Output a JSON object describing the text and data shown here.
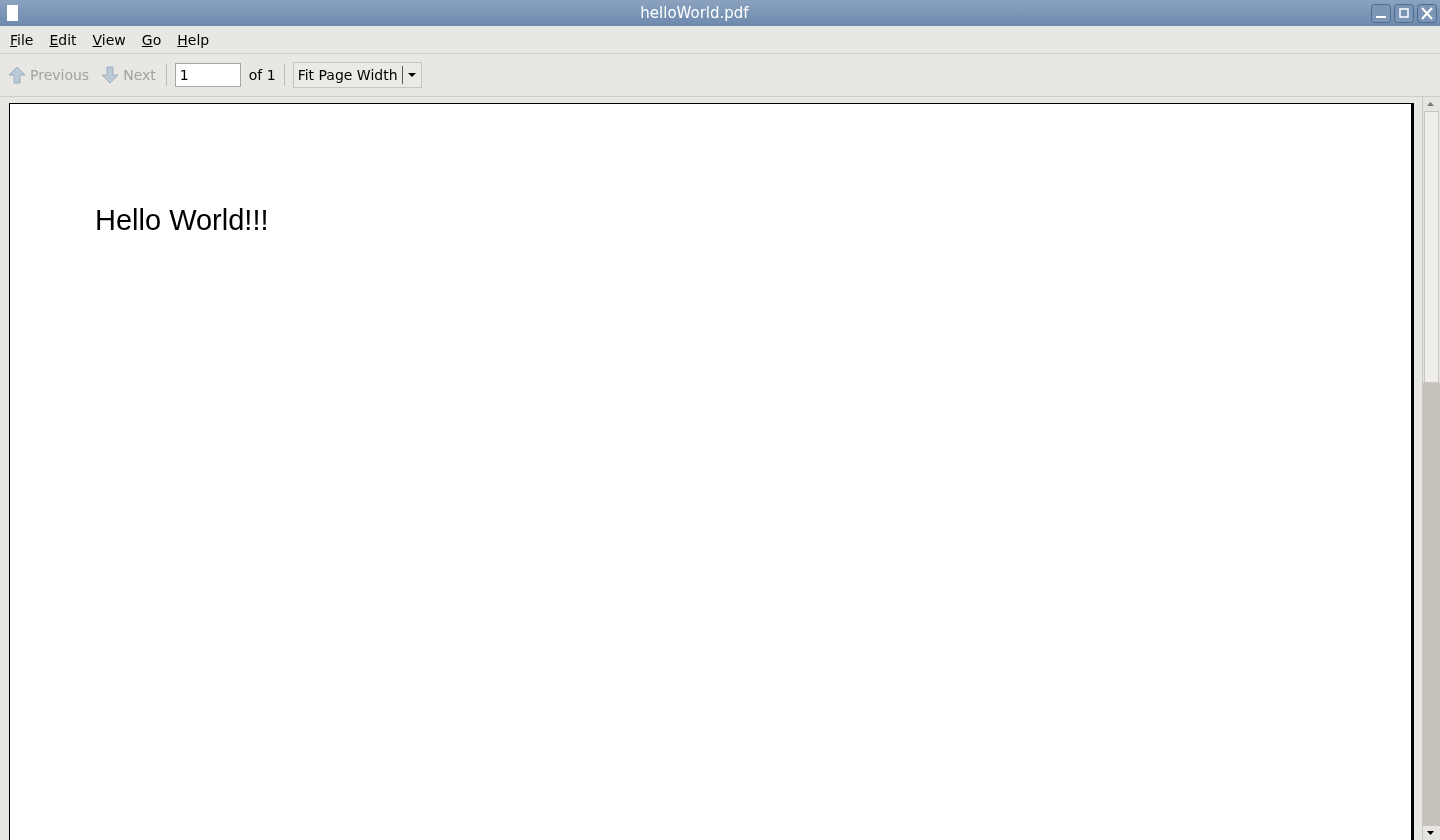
{
  "window": {
    "title": "helloWorld.pdf"
  },
  "menu": [
    {
      "label": "File"
    },
    {
      "label": "Edit"
    },
    {
      "label": "View"
    },
    {
      "label": "Go"
    },
    {
      "label": "Help"
    }
  ],
  "toolbar": {
    "previous": {
      "label": "Previous",
      "disabled": true
    },
    "next": {
      "label": "Next",
      "disabled": true
    },
    "page_field": {
      "value": "1"
    },
    "page_count": "of 1",
    "zoom": {
      "value": "Fit Page Width"
    }
  },
  "document": {
    "text": "Hello World!!!"
  }
}
